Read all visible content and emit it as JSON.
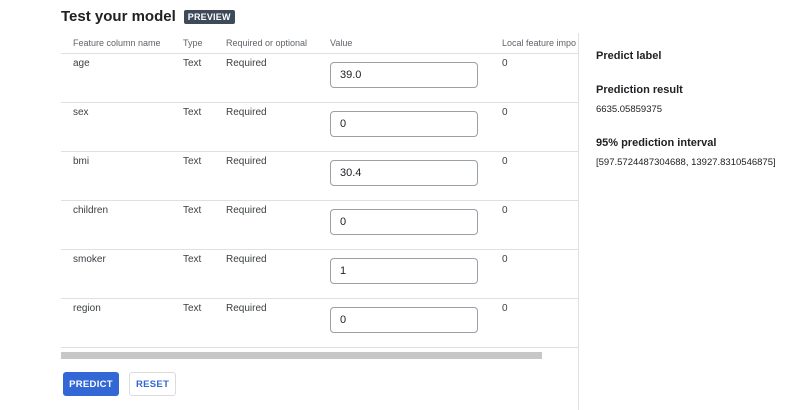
{
  "header": {
    "title": "Test your model",
    "badge": "PREVIEW"
  },
  "table": {
    "columns": {
      "name": "Feature column name",
      "type": "Type",
      "required": "Required or optional",
      "value": "Value",
      "importance": "Local feature impo"
    },
    "rows": [
      {
        "name": "age",
        "type": "Text",
        "required": "Required",
        "value": "39.0",
        "importance": "0"
      },
      {
        "name": "sex",
        "type": "Text",
        "required": "Required",
        "value": "0",
        "importance": "0"
      },
      {
        "name": "bmi",
        "type": "Text",
        "required": "Required",
        "value": "30.4",
        "importance": "0"
      },
      {
        "name": "children",
        "type": "Text",
        "required": "Required",
        "value": "0",
        "importance": "0"
      },
      {
        "name": "smoker",
        "type": "Text",
        "required": "Required",
        "value": "1",
        "importance": "0"
      },
      {
        "name": "region",
        "type": "Text",
        "required": "Required",
        "value": "0",
        "importance": "0"
      }
    ]
  },
  "buttons": {
    "predict": "PREDICT",
    "reset": "RESET"
  },
  "side": {
    "predict_label": "Predict label",
    "result_heading": "Prediction result",
    "result_value": "6635.05859375",
    "interval_heading": "95% prediction interval",
    "interval_value": "[597.5724487304688, 13927.8310546875]"
  },
  "colors": {
    "primary": "#3367d6",
    "badge": "#3c4a5a"
  }
}
